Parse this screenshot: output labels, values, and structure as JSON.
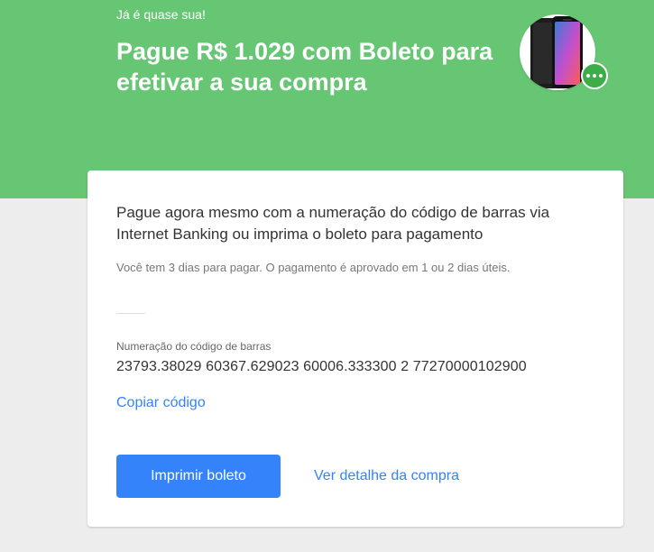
{
  "hero": {
    "eyebrow": "Já é quase sua!",
    "title": "Pague R$ 1.029 com Boleto para efetivar a sua compra",
    "background_color": "#66c674",
    "product_image_icon": "phone-product-image",
    "badge_icon": "more-options-icon"
  },
  "card": {
    "heading": "Pague agora mesmo com a numeração do código de barras via Internet Banking ou imprima o boleto para pagamento",
    "subtext": "Você tem 3 dias para pagar. O pagamento é aprovado em 1 ou 2 dias úteis.",
    "barcode_label": "Numeração do código de barras",
    "barcode_value": "23793.38029 60367.629023 60006.333300 2 77270000102900",
    "copy_link": "Copiar código",
    "print_button": "Imprimir boleto",
    "details_link": "Ver detalhe da compra",
    "accent_color": "#3483fa"
  }
}
